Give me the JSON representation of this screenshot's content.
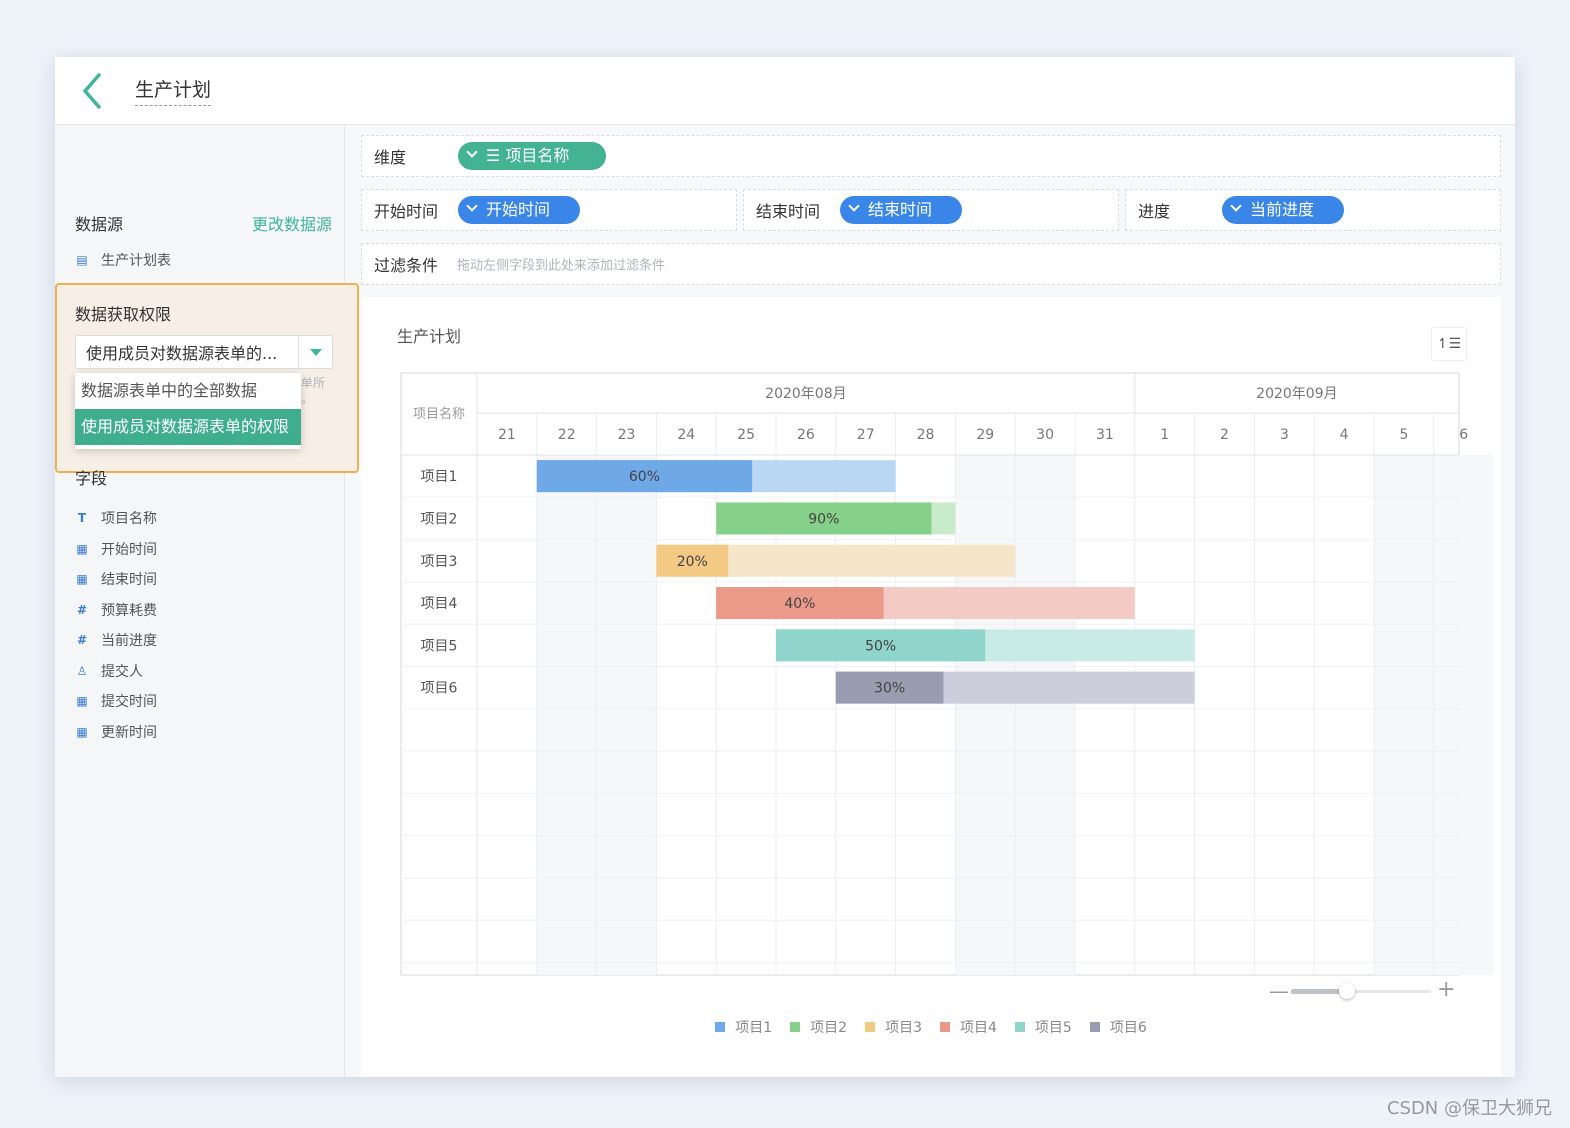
{
  "topbar": {
    "title": "生产计划"
  },
  "sidebar": {
    "datasource_label": "数据源",
    "change_datasource": "更改数据源",
    "datasource_name": "生产计划表",
    "permission_label": "数据获取权限",
    "permission_selected": "使用成员对数据源表单的...",
    "permission_options": [
      "数据源表单中的全部数据",
      "使用成员对数据源表单的权限"
    ],
    "permission_hint_lines": [
      "单所",
      "。"
    ],
    "fields_label": "字段",
    "fields": [
      {
        "icon": "text-icon",
        "glyph": "T",
        "label": "项目名称"
      },
      {
        "icon": "calendar-icon",
        "glyph": "▦",
        "label": "开始时间"
      },
      {
        "icon": "calendar-icon",
        "glyph": "▦",
        "label": "结束时间"
      },
      {
        "icon": "number-icon",
        "glyph": "#",
        "label": "预算耗费"
      },
      {
        "icon": "number-icon",
        "glyph": "#",
        "label": "当前进度"
      },
      {
        "icon": "user-icon",
        "glyph": "♙",
        "label": "提交人"
      },
      {
        "icon": "calendar-icon",
        "glyph": "▦",
        "label": "提交时间"
      },
      {
        "icon": "calendar-icon",
        "glyph": "▦",
        "label": "更新时间"
      }
    ]
  },
  "config": {
    "dimension_label": "维度",
    "dimension_value": "☰ 项目名称",
    "start_label": "开始时间",
    "start_value": "开始时间",
    "end_label": "结束时间",
    "end_value": "结束时间",
    "progress_label": "进度",
    "progress_value": "当前进度",
    "filter_label": "过滤条件",
    "filter_hint": "拖动左侧字段到此处来添加过滤条件"
  },
  "chart": {
    "title": "生产计划"
  },
  "chart_data": {
    "type": "gantt",
    "title": "生产计划",
    "row_header": "项目名称",
    "months": [
      {
        "label": "2020年08月",
        "days": [
          "21",
          "22",
          "23",
          "24",
          "25",
          "26",
          "27",
          "28",
          "29",
          "30",
          "31"
        ]
      },
      {
        "label": "2020年09月",
        "days": [
          "1",
          "2",
          "3",
          "4",
          "5",
          "6"
        ]
      }
    ],
    "tasks": [
      {
        "name": "项目1",
        "start": "2020-08-22",
        "end": "2020-08-27",
        "progress": 60,
        "color": "#6fa8e6",
        "color_light": "#b9d6f3"
      },
      {
        "name": "项目2",
        "start": "2020-08-25",
        "end": "2020-08-28",
        "progress": 90,
        "color": "#86d18a",
        "color_light": "#c8ebca"
      },
      {
        "name": "项目3",
        "start": "2020-08-24",
        "end": "2020-08-29",
        "progress": 20,
        "color": "#f3c983",
        "color_light": "#f5e5c9"
      },
      {
        "name": "项目4",
        "start": "2020-08-25",
        "end": "2020-08-31",
        "progress": 40,
        "color": "#eb9a8a",
        "color_light": "#f4cbc4"
      },
      {
        "name": "项目5",
        "start": "2020-08-26",
        "end": "2020-09-01",
        "progress": 50,
        "color": "#8fd5cb",
        "color_light": "#c9ebe6"
      },
      {
        "name": "项目6",
        "start": "2020-08-27",
        "end": "2020-09-01",
        "progress": 30,
        "color": "#9a9cb2",
        "color_light": "#ccccda"
      }
    ],
    "legend": [
      "项目1",
      "项目2",
      "项目3",
      "项目4",
      "项目5",
      "项目6"
    ],
    "zoom_level": 0.4
  },
  "watermark": "CSDN @保卫大狮兄"
}
